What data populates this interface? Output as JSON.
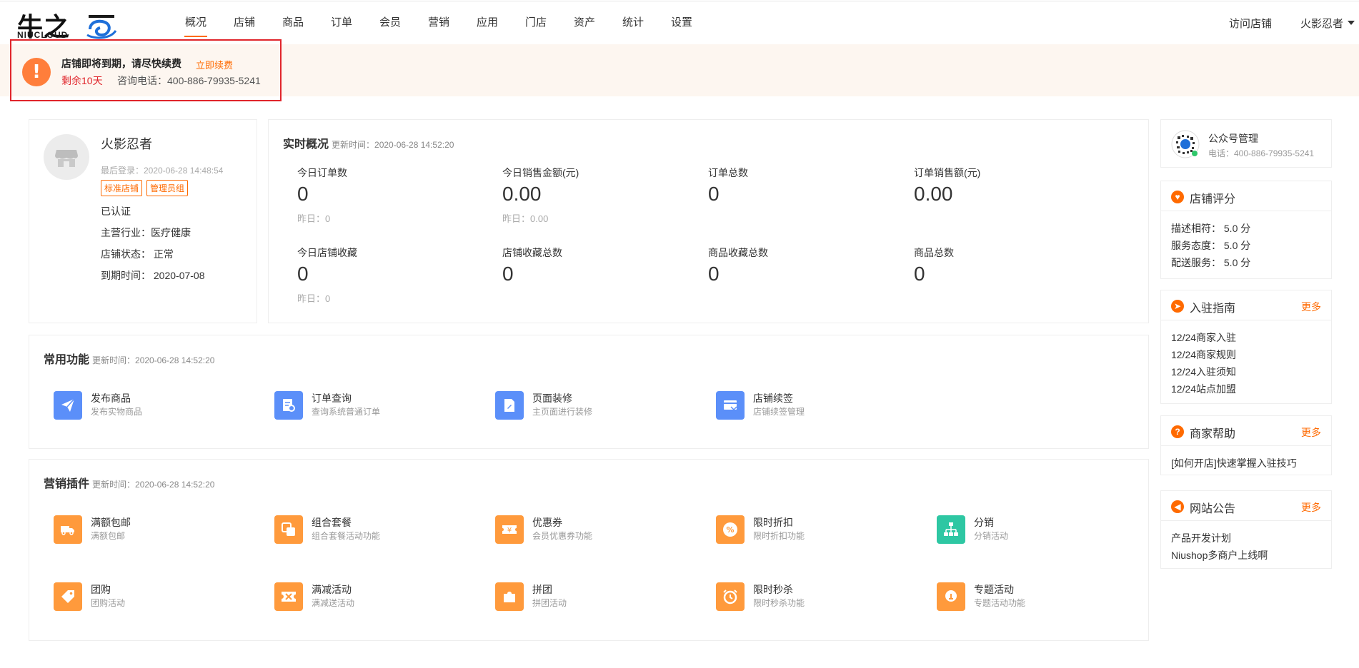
{
  "header": {
    "logo_text": "牛之",
    "logo_sub": "NIUCLOUD",
    "nav": [
      "概况",
      "店铺",
      "商品",
      "订单",
      "会员",
      "营销",
      "应用",
      "门店",
      "资产",
      "统计",
      "设置"
    ],
    "active_nav": "概况",
    "visit_shop": "访问店铺",
    "user": "火影忍者",
    "accent": "#ff6a00"
  },
  "notice": {
    "title": "店铺即将到期，请尽快续费",
    "renew": "立即续费",
    "days_left": "剩余10天",
    "phone": "咨询电话：400-886-79935-5241"
  },
  "shop": {
    "name": "火影忍者",
    "last_login": "最后登录：2020-06-28 14:48:54",
    "tags": [
      "标准店铺",
      "管理员组"
    ],
    "verified": "已认证",
    "industry": "主营行业：医疗健康",
    "status": "店铺状态：  正常",
    "expire": "到期时间：  2020-07-08"
  },
  "realtime": {
    "title": "实时概况",
    "update": "更新时间：2020-06-28 14:52:20",
    "stats": [
      {
        "label": "今日订单数",
        "value": "0",
        "yesterday": "昨日：0"
      },
      {
        "label": "今日销售金额(元)",
        "value": "0.00",
        "yesterday": "昨日：0.00"
      },
      {
        "label": "订单总数",
        "value": "0",
        "yesterday": ""
      },
      {
        "label": "订单销售额(元)",
        "value": "0.00",
        "yesterday": ""
      },
      {
        "label": "今日店铺收藏",
        "value": "0",
        "yesterday": "昨日：0"
      },
      {
        "label": "店铺收藏总数",
        "value": "0",
        "yesterday": ""
      },
      {
        "label": "商品收藏总数",
        "value": "0",
        "yesterday": ""
      },
      {
        "label": "商品总数",
        "value": "0",
        "yesterday": ""
      }
    ]
  },
  "common": {
    "title": "常用功能",
    "update": "更新时间：2020-06-28 14:52:20",
    "items": [
      {
        "title": "发布商品",
        "desc": "发布实物商品"
      },
      {
        "title": "订单查询",
        "desc": "查询系统普通订单"
      },
      {
        "title": "页面装修",
        "desc": "主页面进行装修"
      },
      {
        "title": "店铺续签",
        "desc": "店铺续签管理"
      }
    ]
  },
  "plugins": {
    "title": "营销插件",
    "update": "更新时间：2020-06-28 14:52:20",
    "items": [
      {
        "title": "满额包邮",
        "desc": "满额包邮"
      },
      {
        "title": "组合套餐",
        "desc": "组合套餐活动功能"
      },
      {
        "title": "优惠券",
        "desc": "会员优惠券功能"
      },
      {
        "title": "限时折扣",
        "desc": "限时折扣功能"
      },
      {
        "title": "分销",
        "desc": "分销活动"
      },
      {
        "title": "团购",
        "desc": "团购活动"
      },
      {
        "title": "满减活动",
        "desc": "满减送活动"
      },
      {
        "title": "拼团",
        "desc": "拼团活动"
      },
      {
        "title": "限时秒杀",
        "desc": "限时秒杀功能"
      },
      {
        "title": "专题活动",
        "desc": "专题活动功能"
      }
    ]
  },
  "side": {
    "wechat": {
      "title": "公众号管理",
      "phone": "电话：400-886-79935-5241"
    },
    "rating": {
      "title": "店铺评分",
      "lines": [
        "描述相符：  5.0 分",
        "服务态度：  5.0 分",
        "配送服务：  5.0 分"
      ]
    },
    "guide": {
      "title": "入驻指南",
      "more": "更多",
      "lines": [
        "12/24商家入驻",
        "12/24商家规则",
        "12/24入驻须知",
        "12/24站点加盟"
      ]
    },
    "help": {
      "title": "商家帮助",
      "more": "更多",
      "lines": [
        "[如何开店]快速掌握入驻技巧"
      ]
    },
    "news": {
      "title": "网站公告",
      "more": "更多",
      "lines": [
        "产品开发计划",
        "Niushop多商户上线啊"
      ]
    }
  }
}
